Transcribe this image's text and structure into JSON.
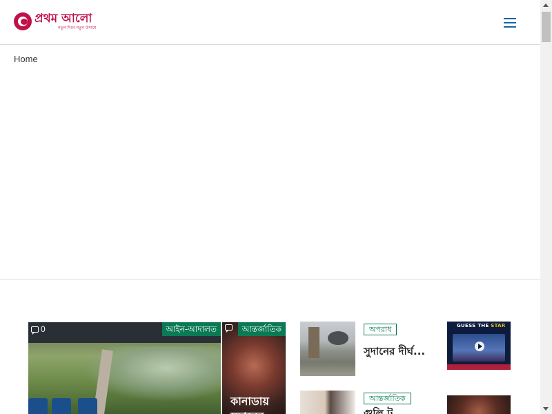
{
  "header": {
    "logo_title": "প্রথম আলো",
    "logo_tagline": "নতুন দিনে নতুন উদ্যমে",
    "brand_color": "#c0114a",
    "menu_icon": "hamburger-menu-icon"
  },
  "breadcrumb": {
    "home": "Home"
  },
  "news": {
    "big_card": {
      "comments": "0",
      "category": "আইন-আদালত"
    },
    "mid_card": {
      "category": "আন্তর্জাতিক",
      "headline": "কানাডায় সুদানের"
    },
    "list": [
      {
        "category": "অপরাধ",
        "title": "সুদানের দীর্ঘ..."
      },
      {
        "category": "আন্তর্জাতিক",
        "title": "গুলি ট"
      }
    ],
    "video": {
      "banner_a": "GUESS THE",
      "banner_b": "STAR"
    }
  },
  "colors": {
    "tag_green": "#0a7a54",
    "menu_blue": "#1565a5"
  }
}
